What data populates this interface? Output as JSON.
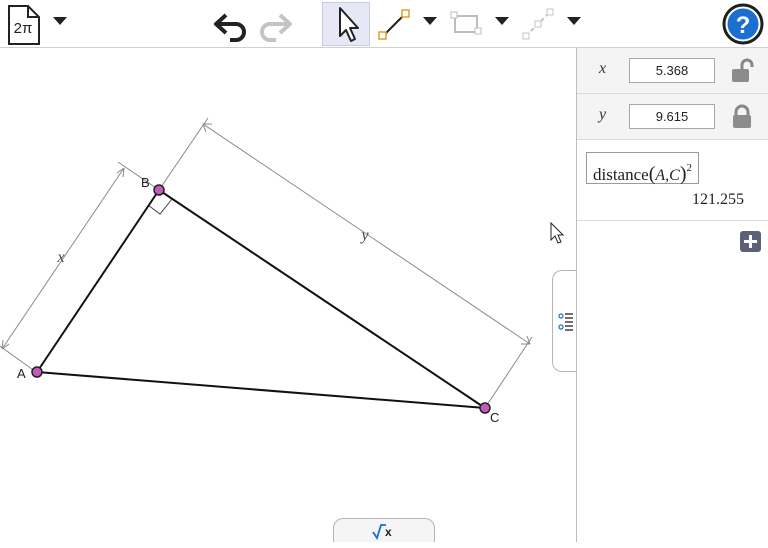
{
  "toolbar": {
    "app_icon_label": "2π"
  },
  "sliders": [
    {
      "name": "x",
      "value": "5.368",
      "locked": false
    },
    {
      "name": "y",
      "value": "9.615",
      "locked": true
    }
  ],
  "expression": {
    "func": "distance",
    "args": "A,C",
    "power": "2",
    "result": "121.255"
  },
  "canvas": {
    "points": {
      "A": "A",
      "B": "B",
      "C": "C"
    },
    "dimensions": {
      "x": "x",
      "y": "y"
    }
  }
}
